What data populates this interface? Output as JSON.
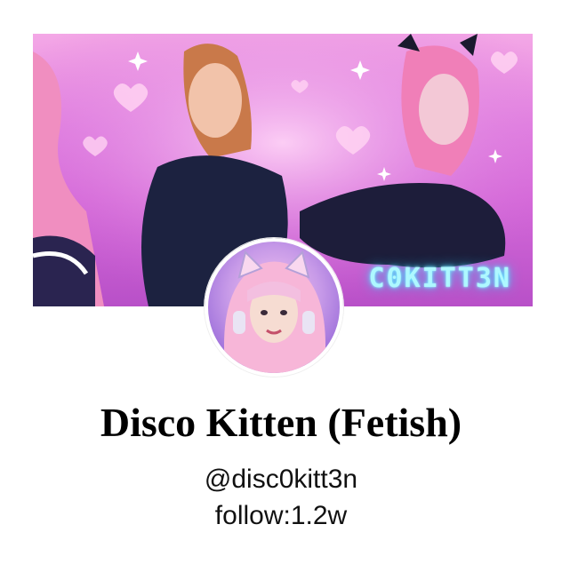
{
  "profile": {
    "banner_text": "C0KITT3N",
    "display_name": "Disco Kitten (Fetish)",
    "handle": "@disc0kitt3n",
    "followers": "follow:1.2w"
  },
  "colors": {
    "banner_pink": "#e07fe0",
    "neon_text": "#aef8ff",
    "avatar_ring": "#ffffff"
  }
}
